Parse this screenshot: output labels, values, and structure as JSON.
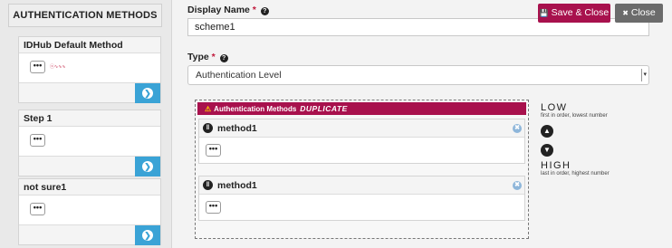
{
  "sidebar": {
    "title": "AUTHENTICATION METHODS",
    "cards": [
      {
        "title": "IDHub Default Method",
        "menu": "•••",
        "arrow": "❯",
        "has_logo": true
      },
      {
        "title": "Step 1",
        "menu": "•••",
        "arrow": "❯",
        "has_logo": false
      },
      {
        "title": "not sure1",
        "menu": "•••",
        "arrow": "❯",
        "has_logo": false
      }
    ]
  },
  "form": {
    "display_name_label": "Display Name",
    "display_name_value": "scheme1",
    "type_label": "Type",
    "type_value": "Authentication Level",
    "required_marker": "*",
    "help_glyph": "?"
  },
  "toolbar": {
    "save_label": "Save & Close",
    "close_label": "Close",
    "save_icon": "💾",
    "close_icon": "✖"
  },
  "dropzone": {
    "banner_text": "Authentication Methods",
    "banner_flag": "DUPLICATE",
    "warning_icon": "⚠",
    "items": [
      {
        "name": "method1",
        "menu": "•••",
        "remove": "✖",
        "handle": "‖"
      },
      {
        "name": "method1",
        "menu": "•••",
        "remove": "✖",
        "handle": "‖"
      }
    ]
  },
  "order": {
    "low_label": "LOW",
    "low_sub": "first in order, lowest number",
    "high_label": "HIGH",
    "high_sub": "last in order, highest number",
    "up_glyph": "▲",
    "down_glyph": "▼"
  },
  "colors": {
    "accent": "#a8114d",
    "info": "#3aa3d6",
    "neutral_button": "#6b6b6b"
  }
}
